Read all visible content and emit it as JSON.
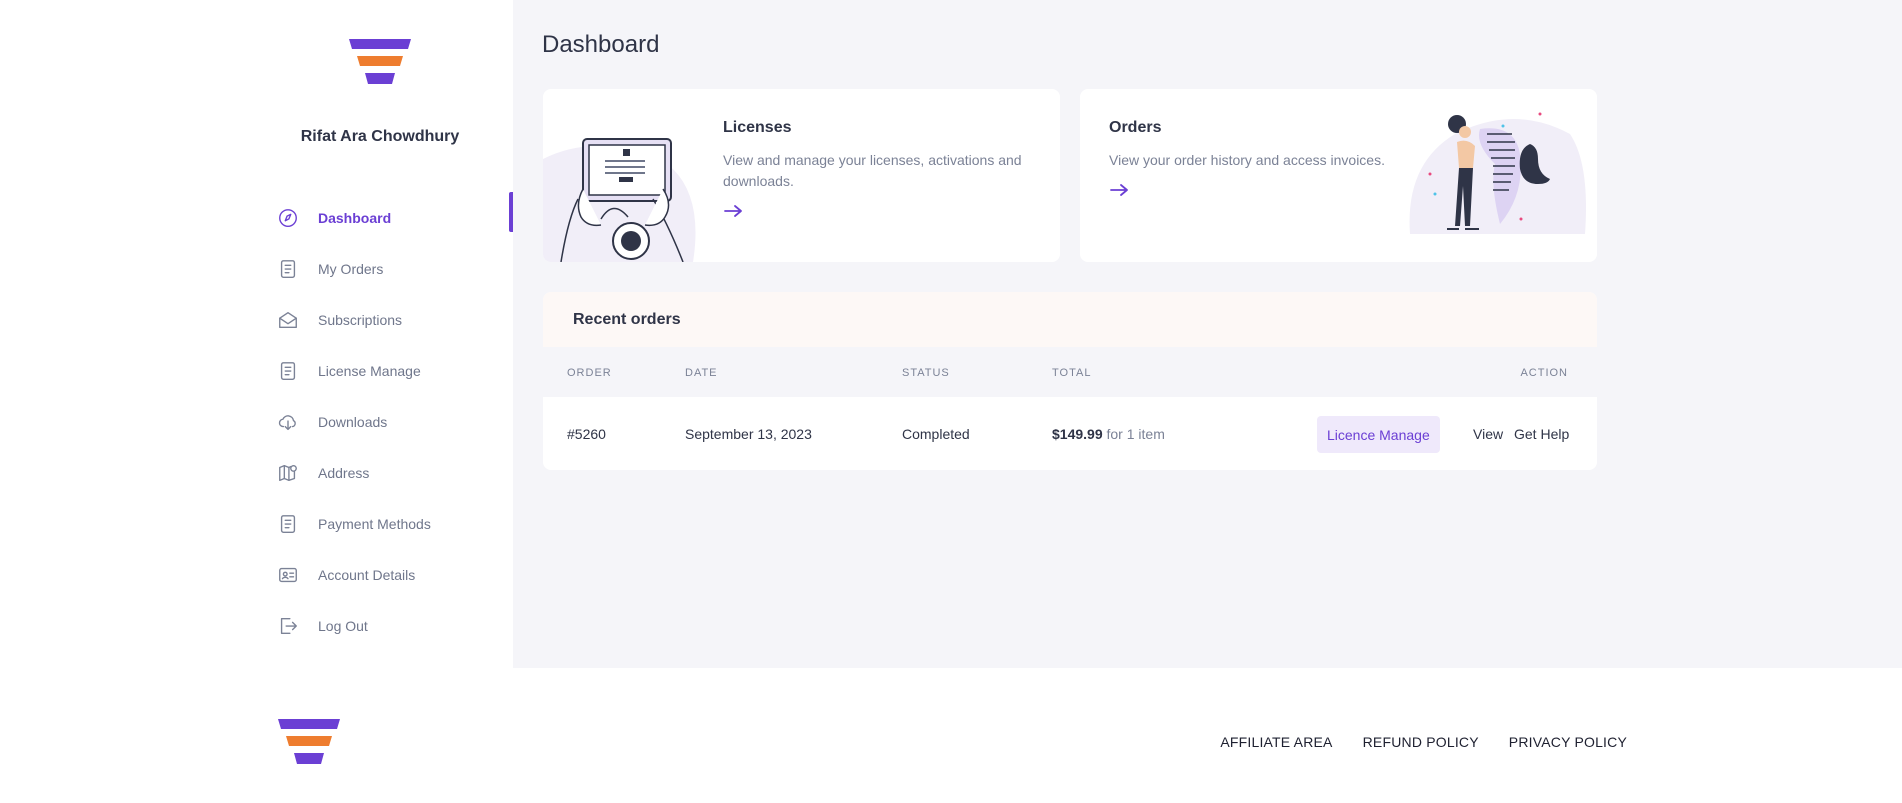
{
  "brand": {
    "logo_colors": [
      "#6b3fd4",
      "#ee7d2f",
      "#6b3fd4"
    ]
  },
  "user": {
    "name": "Rifat Ara Chowdhury"
  },
  "sidebar": {
    "items": [
      {
        "label": "Dashboard",
        "icon": "dashboard-icon",
        "active": true
      },
      {
        "label": "My Orders",
        "icon": "document-icon"
      },
      {
        "label": "Subscriptions",
        "icon": "envelope-icon"
      },
      {
        "label": "License Manage",
        "icon": "document-icon"
      },
      {
        "label": "Downloads",
        "icon": "cloud-download-icon"
      },
      {
        "label": "Address",
        "icon": "map-icon"
      },
      {
        "label": "Payment Methods",
        "icon": "document-icon"
      },
      {
        "label": "Account Details",
        "icon": "id-card-icon"
      },
      {
        "label": "Log Out",
        "icon": "logout-icon"
      }
    ]
  },
  "main": {
    "title": "Dashboard",
    "cards": {
      "licenses": {
        "title": "Licenses",
        "description": "View and manage your licenses, activations and downloads."
      },
      "orders": {
        "title": "Orders",
        "description": "View your order history and access invoices."
      }
    },
    "recent_orders": {
      "title": "Recent orders",
      "columns": {
        "order": "ORDER",
        "date": "DATE",
        "status": "STATUS",
        "total": "TOTAL",
        "action": "ACTION"
      },
      "rows": [
        {
          "order": "#5260",
          "date": "September 13, 2023",
          "status": "Completed",
          "total": "$149.99",
          "total_suffix": "for 1 item",
          "manage_label": "Licence Manage",
          "view_label": "View",
          "help_label": "Get Help"
        }
      ]
    }
  },
  "footer": {
    "links": [
      "AFFILIATE AREA",
      "REFUND POLICY",
      "PRIVACY POLICY"
    ]
  },
  "colors": {
    "accent": "#6b3fd4",
    "orange": "#ee7d2f",
    "background": "#f5f5f9"
  }
}
